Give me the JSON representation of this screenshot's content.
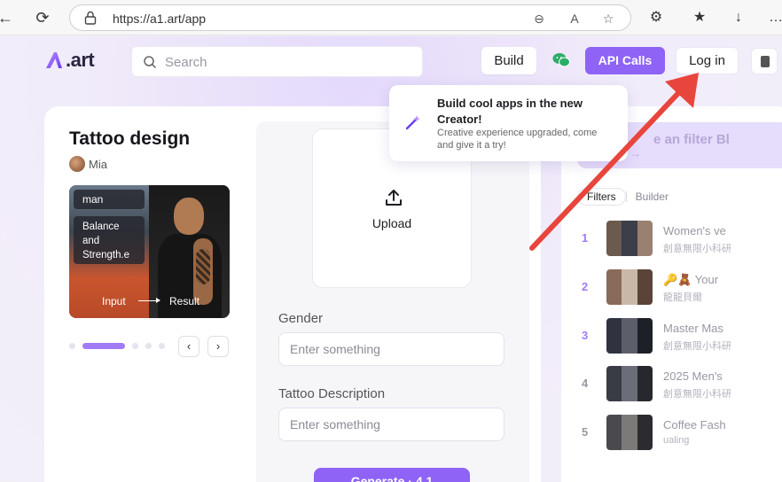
{
  "browser": {
    "url": "https://a1.art/app",
    "back_glyph": "←",
    "refresh_glyph": "⟳",
    "zoom_glyph": "⊖",
    "read_aloud_glyph": "A",
    "favorite_glyph": "☆",
    "extensions_glyph": "⚙",
    "favorites_bar_glyph": "★",
    "downloads_glyph": "↓",
    "more_glyph": "…"
  },
  "header": {
    "logo_text": "art",
    "search_placeholder": "Search",
    "build_label": "Build",
    "api_calls_label": "API Calls",
    "login_label": "Log in"
  },
  "popover": {
    "title": "Build cool apps in the new Creator!",
    "subtitle": "Creative experience upgraded, come and give it a try!"
  },
  "app": {
    "title": "Tattoo design",
    "author": "Mia",
    "preview": {
      "tag_man": "man",
      "tag_desc": "Balance and Strength.e muscle...",
      "input_label": "Input",
      "result_label": "Result"
    },
    "carousel": {
      "prev_glyph": "‹",
      "next_glyph": "›"
    }
  },
  "form": {
    "upload_label": "Upload",
    "gender_label": "Gender",
    "gender_placeholder": "Enter something",
    "tattoo_label": "Tattoo Description",
    "tattoo_placeholder": "Enter something",
    "generate_label": "Generate · 4.1"
  },
  "right_panel": {
    "banner_text": "e an filter Bl",
    "banner_arrow": "→",
    "tabs": [
      "Filters",
      "Builder"
    ],
    "ranking": [
      {
        "rank": "1",
        "title": "Women's ve",
        "subtitle": "創意無限小科研"
      },
      {
        "rank": "2",
        "title": "🔑🧸 Your",
        "subtitle": "龍龍貝爾"
      },
      {
        "rank": "3",
        "title": "Master Mas",
        "subtitle": "創意無限小科研"
      },
      {
        "rank": "4",
        "title": "2025 Men's",
        "subtitle": "創意無限小科研"
      },
      {
        "rank": "5",
        "title": "Coffee Fash",
        "subtitle": "ualing"
      }
    ]
  },
  "colors": {
    "accent": "#8e63f5",
    "annotation": "#e8453c"
  }
}
